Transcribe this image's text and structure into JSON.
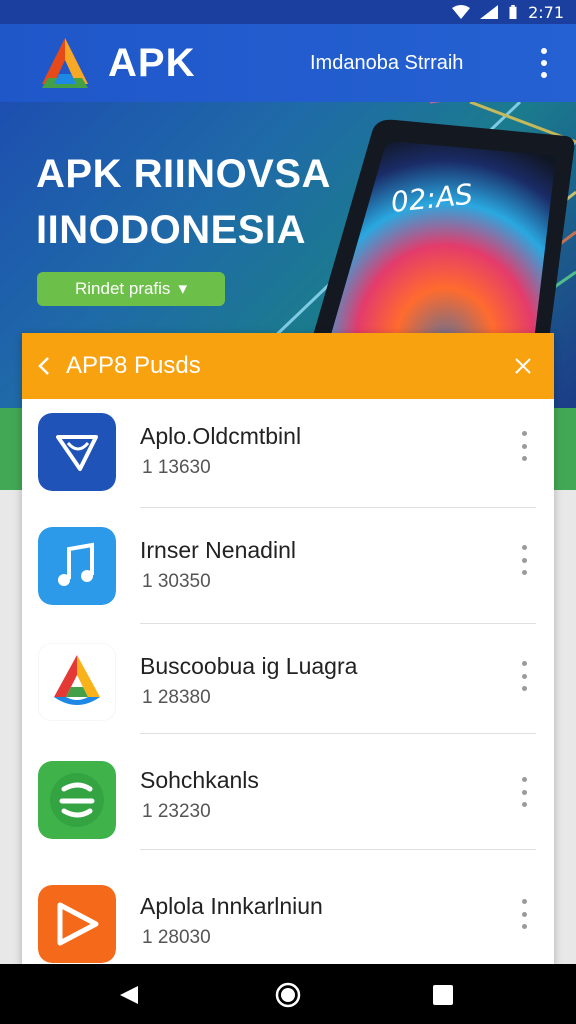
{
  "status_bar": {
    "time": "2:71"
  },
  "app_bar": {
    "title": "APK",
    "subtitle": "Imdanoba Strraih"
  },
  "hero": {
    "title_line1": "APK RIINOVSA",
    "title_line2": "IINODONESIA",
    "button_label": "Rindet prafis",
    "button_arrow": "▾",
    "phone_clock": "02:AS"
  },
  "panel": {
    "title": "APP8 Pusds",
    "items": [
      {
        "name": "Aplo.Oldcmtbinl",
        "size": "1 13630",
        "icon": "shield-app-icon",
        "color": "#1f53b7"
      },
      {
        "name": "Irnser Nenadinl",
        "size": "1 30350",
        "icon": "music-note-icon",
        "color": "#2c9ae8"
      },
      {
        "name": "Buscoobua ig Luagra",
        "size": "1 28380",
        "icon": "multicolor-triangle-icon",
        "color": "#ffffff"
      },
      {
        "name": "Sohchkanls",
        "size": "1 23230",
        "icon": "s-logo-icon",
        "color": "#3fb34a"
      },
      {
        "name": "Aplola Innkarlniun",
        "size": "1 28030",
        "icon": "play-triangle-icon",
        "color": "#f46a1a"
      }
    ]
  }
}
